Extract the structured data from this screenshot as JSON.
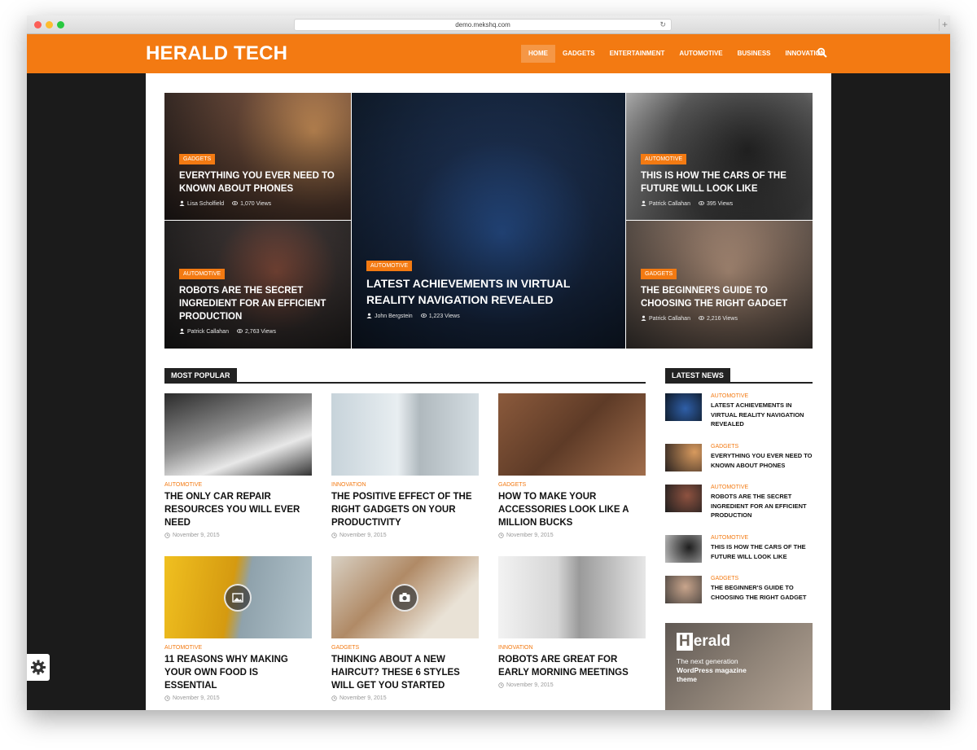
{
  "browser": {
    "url": "demo.mekshq.com",
    "plus": "+"
  },
  "site": {
    "logo": "HERALD TECH"
  },
  "nav": [
    {
      "label": "HOME"
    },
    {
      "label": "GADGETS"
    },
    {
      "label": "ENTERTAINMENT"
    },
    {
      "label": "AUTOMOTIVE"
    },
    {
      "label": "BUSINESS"
    },
    {
      "label": "INNOVATION"
    }
  ],
  "featured": [
    {
      "category": "GADGETS",
      "title": "EVERYTHING YOU EVER NEED TO KNOWN ABOUT PHONES",
      "author": "Lisa Scholfield",
      "views": "1,070 Views"
    },
    {
      "category": "AUTOMOTIVE",
      "title": "ROBOTS ARE THE SECRET INGREDIENT FOR AN EFFICIENT PRODUCTION",
      "author": "Patrick Callahan",
      "views": "2,763 Views"
    },
    {
      "category": "AUTOMOTIVE",
      "title": "LATEST ACHIEVEMENTS IN VIRTUAL REALITY NAVIGATION REVEALED",
      "author": "John Bergstein",
      "views": "1,223 Views"
    },
    {
      "category": "AUTOMOTIVE",
      "title": "THIS IS HOW THE CARS OF THE FUTURE WILL LOOK LIKE",
      "author": "Patrick Callahan",
      "views": "395 Views"
    },
    {
      "category": "GADGETS",
      "title": "THE BEGINNER'S GUIDE TO CHOOSING THE RIGHT GADGET",
      "author": "Patrick Callahan",
      "views": "2,216 Views"
    }
  ],
  "most_popular": {
    "label": "MOST POPULAR",
    "posts": [
      {
        "category": "AUTOMOTIVE",
        "title": "THE ONLY CAR REPAIR RESOURCES YOU WILL EVER NEED",
        "date": "November 9, 2015"
      },
      {
        "category": "INNOVATION",
        "title": "THE POSITIVE EFFECT OF THE RIGHT GADGETS ON YOUR PRODUCTIVITY",
        "date": "November 9, 2015"
      },
      {
        "category": "GADGETS",
        "title": "HOW TO MAKE YOUR ACCESSORIES LOOK LIKE A MILLION BUCKS",
        "date": "November 9, 2015"
      },
      {
        "category": "AUTOMOTIVE",
        "title": "11 REASONS WHY MAKING YOUR OWN FOOD IS ESSENTIAL",
        "date": "November 9, 2015"
      },
      {
        "category": "GADGETS",
        "title": "THINKING ABOUT A NEW HAIRCUT? THESE 6 STYLES WILL GET YOU STARTED",
        "date": "November 9, 2015"
      },
      {
        "category": "INNOVATION",
        "title": "ROBOTS ARE GREAT FOR EARLY MORNING MEETINGS",
        "date": "November 9, 2015"
      }
    ]
  },
  "latest_news": {
    "label": "LATEST NEWS",
    "items": [
      {
        "category": "AUTOMOTIVE",
        "title": "LATEST ACHIEVEMENTS IN VIRTUAL REALITY NAVIGATION REVEALED"
      },
      {
        "category": "GADGETS",
        "title": "EVERYTHING YOU EVER NEED TO KNOWN ABOUT PHONES"
      },
      {
        "category": "AUTOMOTIVE",
        "title": "ROBOTS ARE THE SECRET INGREDIENT FOR AN EFFICIENT PRODUCTION"
      },
      {
        "category": "AUTOMOTIVE",
        "title": "THIS IS HOW THE CARS OF THE FUTURE WILL LOOK LIKE"
      },
      {
        "category": "GADGETS",
        "title": "THE BEGINNER'S GUIDE TO CHOOSING THE RIGHT GADGET"
      }
    ]
  },
  "ad": {
    "logo_rest": "erald",
    "logo_first": "H",
    "line1": "The next generation",
    "line2": "WordPress magazine theme"
  },
  "colors": {
    "accent": "#f37a12",
    "dark": "#222222"
  },
  "icons": [
    "search-icon",
    "user-icon",
    "eye-icon",
    "clock-icon",
    "gear-icon",
    "image-icon",
    "camera-icon",
    "reload-icon"
  ]
}
